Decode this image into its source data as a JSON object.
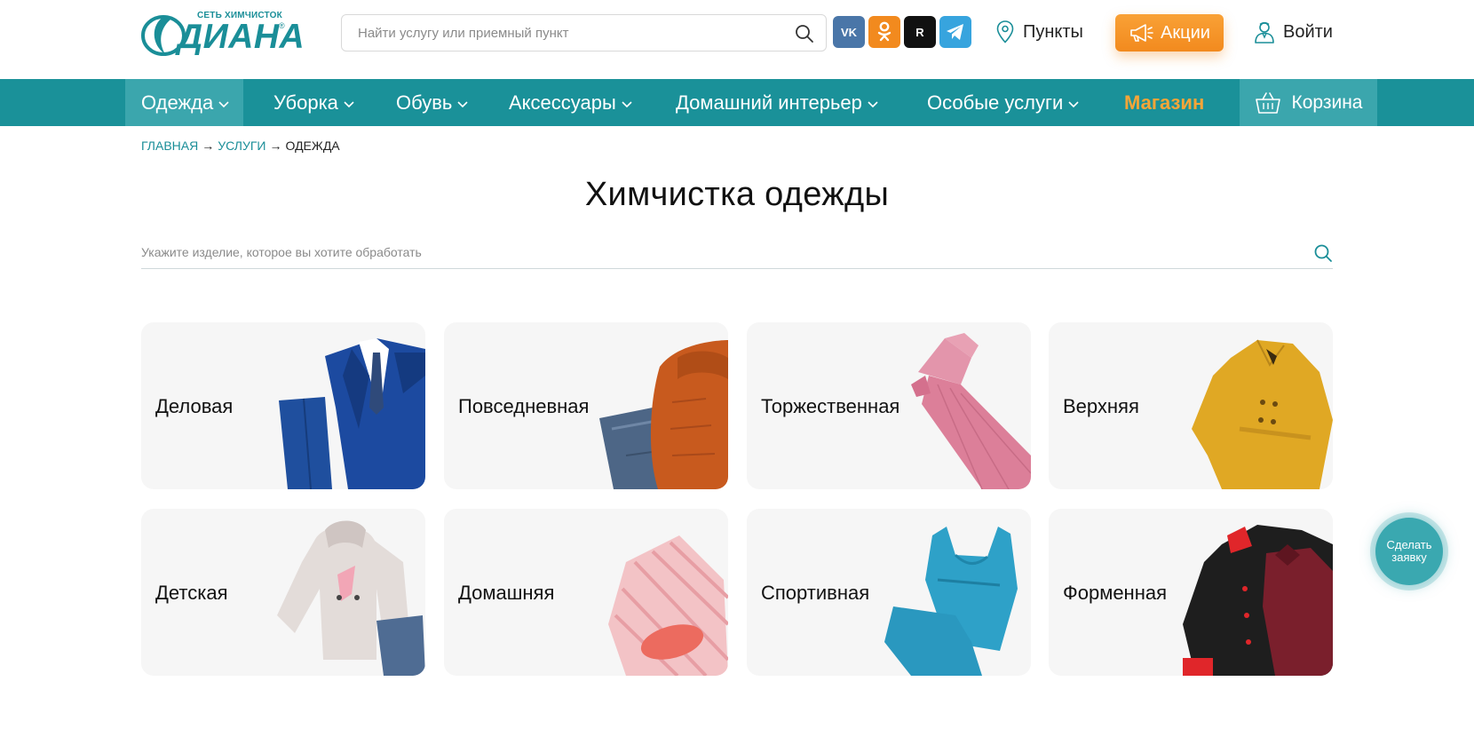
{
  "header": {
    "logo": {
      "subtitle": "СЕТЬ ХИМЧИСТОК",
      "name": "ДИАНА",
      "reg": "®"
    },
    "search": {
      "placeholder": "Найти услугу или приемный пункт",
      "value": ""
    },
    "socials": [
      {
        "name": "vk",
        "label": "VK"
      },
      {
        "name": "ok",
        "label": "ОК"
      },
      {
        "name": "rutube",
        "label": "R"
      },
      {
        "name": "telegram",
        "label": ""
      }
    ],
    "points_label": "Пункты",
    "promo_label": "Акции",
    "login_label": "Войти"
  },
  "nav": {
    "items": [
      {
        "label": "Одежда",
        "active": true,
        "dropdown": true
      },
      {
        "label": "Уборка",
        "dropdown": true
      },
      {
        "label": "Обувь",
        "dropdown": true
      },
      {
        "label": "Аксессуары",
        "dropdown": true
      },
      {
        "label": "Домашний интерьер",
        "dropdown": true
      },
      {
        "label": "Особые услуги",
        "dropdown": true
      },
      {
        "label": "Магазин",
        "dropdown": false
      }
    ],
    "cart_label": "Корзина"
  },
  "breadcrumb": {
    "items": [
      "Главная",
      "Услуги",
      "Одежда"
    ],
    "separator": "→"
  },
  "page": {
    "title": "Химчистка одежды",
    "filter_placeholder": "Укажите изделие, которое вы хотите обработать"
  },
  "categories": [
    {
      "label": "Деловая",
      "icon": "business-suit-image"
    },
    {
      "label": "Повседневная",
      "icon": "casual-clothes-image"
    },
    {
      "label": "Торжественная",
      "icon": "evening-dress-image"
    },
    {
      "label": "Верхняя",
      "icon": "trench-coat-image"
    },
    {
      "label": "Детская",
      "icon": "kids-sweater-image"
    },
    {
      "label": "Домашняя",
      "icon": "pajamas-image"
    },
    {
      "label": "Спортивная",
      "icon": "sportswear-image"
    },
    {
      "label": "Форменная",
      "icon": "chef-uniform-image"
    }
  ],
  "float_button_label": "Сделать заявку",
  "colors": {
    "teal": "#1a9199",
    "teal_active": "#3ba6ad",
    "orange": "#f28a1e",
    "shop_orange": "#f7a537",
    "card_bg": "#f6f6f6"
  }
}
